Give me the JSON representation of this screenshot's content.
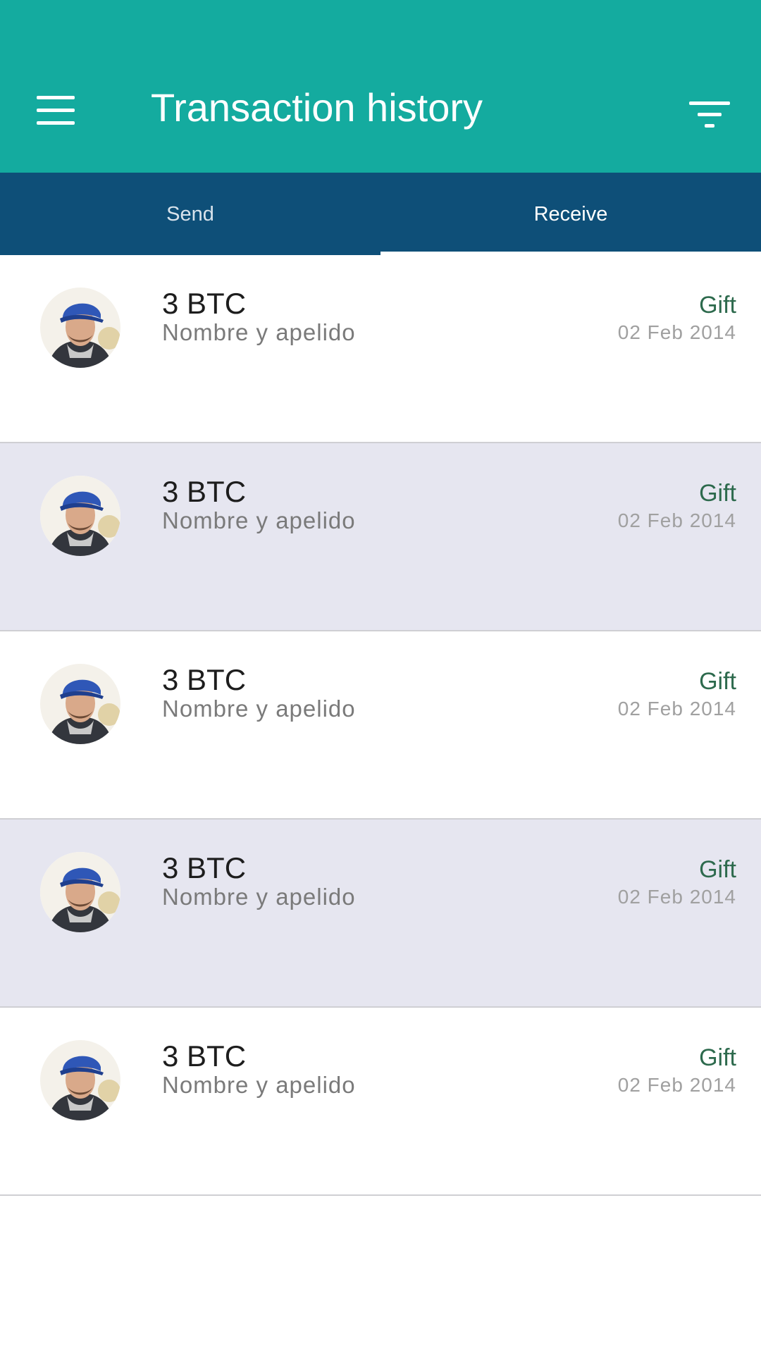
{
  "header": {
    "title": "Transaction history",
    "menu_icon": "hamburger-menu-icon",
    "filter_icon": "filter-icon"
  },
  "tabs": [
    {
      "label": "Send",
      "active": false
    },
    {
      "label": "Receive",
      "active": true
    }
  ],
  "colors": {
    "appbar": "#14ab9f",
    "tabbar": "#0e4f78",
    "row_alt": "#e6e6f0",
    "type_text": "#2d6a4d"
  },
  "transactions": [
    {
      "amount": "3 BTC",
      "name": "Nombre y apelido",
      "type": "Gift",
      "date": "02 Feb 2014",
      "avatar": "user-avatar"
    },
    {
      "amount": "3 BTC",
      "name": "Nombre y apelido",
      "type": "Gift",
      "date": "02 Feb 2014",
      "avatar": "user-avatar"
    },
    {
      "amount": "3 BTC",
      "name": "Nombre y apelido",
      "type": "Gift",
      "date": "02 Feb 2014",
      "avatar": "user-avatar"
    },
    {
      "amount": "3 BTC",
      "name": "Nombre y apelido",
      "type": "Gift",
      "date": "02 Feb 2014",
      "avatar": "user-avatar"
    },
    {
      "amount": "3 BTC",
      "name": "Nombre y apelido",
      "type": "Gift",
      "date": "02 Feb 2014",
      "avatar": "user-avatar"
    }
  ]
}
